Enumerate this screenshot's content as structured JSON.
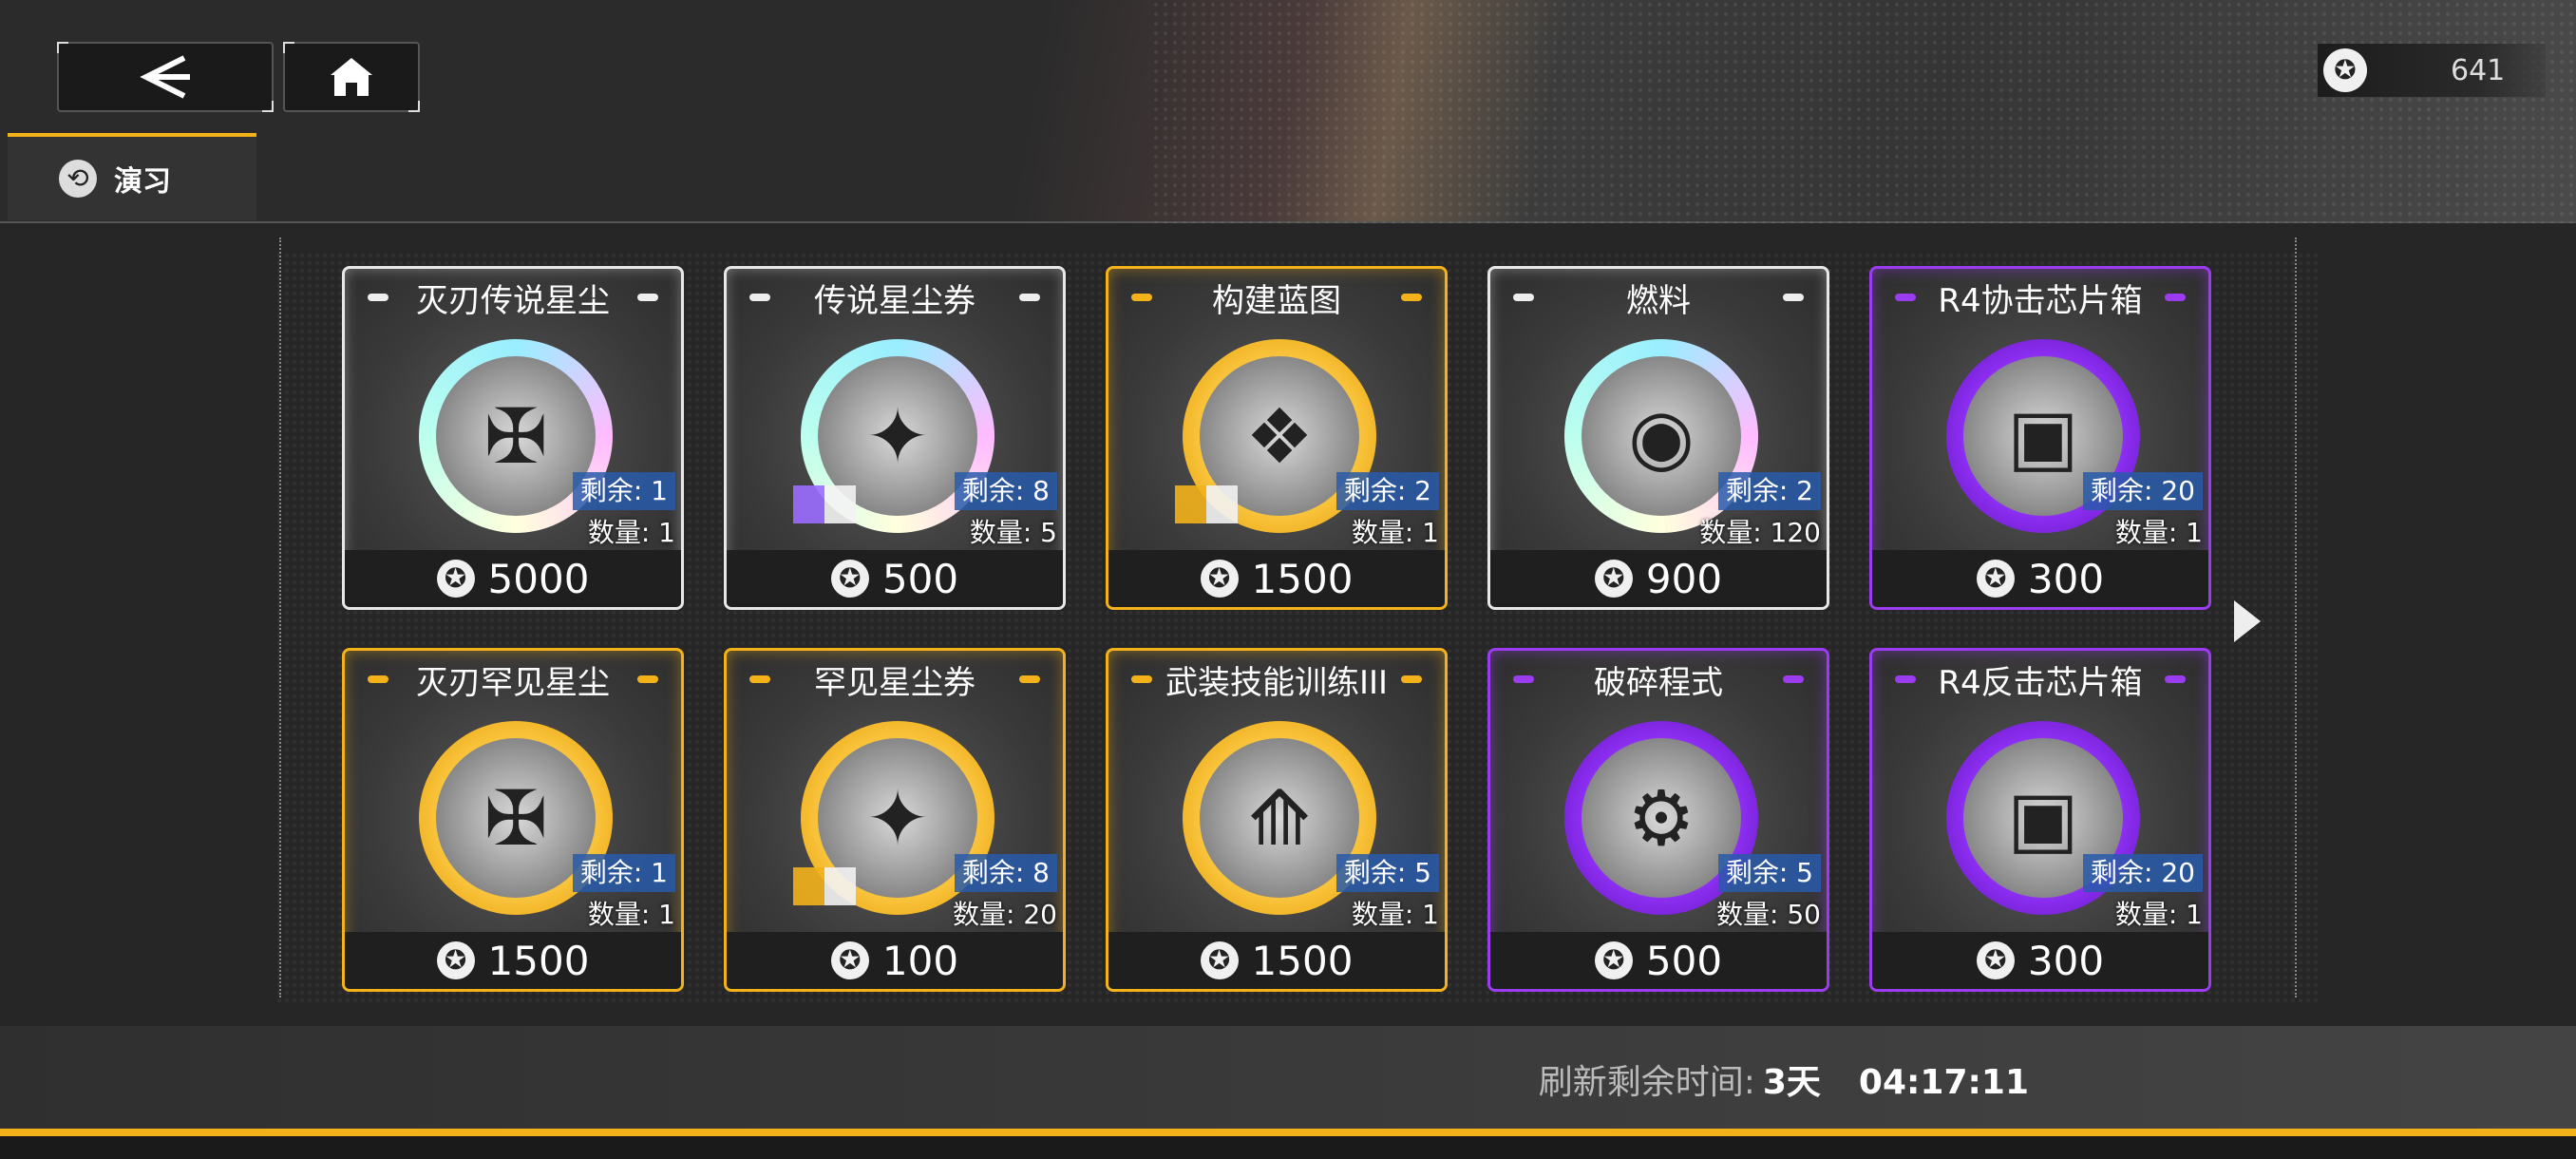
{
  "header": {
    "back_icon": "chevron-left-icon",
    "home_icon": "home-icon",
    "currency": {
      "icon": "star-coin-icon",
      "amount": "641"
    }
  },
  "tab": {
    "icon": "refresh-icon",
    "label": "演习"
  },
  "items": [
    {
      "name": "灭刃传说星尘",
      "rarity": "white",
      "icon": "legend-stardust-icon",
      "remain": "剩余: 1",
      "qty": "数量: 1",
      "price": "5000"
    },
    {
      "name": "传说星尘券",
      "rarity": "white",
      "icon": "legend-ticket-icon",
      "remain": "剩余: 8",
      "qty": "数量: 5",
      "price": "500"
    },
    {
      "name": "构建蓝图",
      "rarity": "gold",
      "icon": "blueprint-icon",
      "remain": "剩余: 2",
      "qty": "数量: 1",
      "price": "1500"
    },
    {
      "name": "燃料",
      "rarity": "white",
      "icon": "fuel-icon",
      "remain": "剩余: 2",
      "qty": "数量: 120",
      "price": "900"
    },
    {
      "name": "R4协击芯片箱",
      "rarity": "purple",
      "icon": "chip-box-icon",
      "remain": "剩余: 20",
      "qty": "数量: 1",
      "price": "300"
    },
    {
      "name": "灭刃罕见星尘",
      "rarity": "gold",
      "icon": "rare-stardust-icon",
      "remain": "剩余: 1",
      "qty": "数量: 1",
      "price": "1500"
    },
    {
      "name": "罕见星尘券",
      "rarity": "gold",
      "icon": "rare-ticket-icon",
      "remain": "剩余: 8",
      "qty": "数量: 20",
      "price": "100"
    },
    {
      "name": "武装技能训练III",
      "rarity": "gold",
      "icon": "skill-training-icon",
      "remain": "剩余: 5",
      "qty": "数量: 1",
      "price": "1500"
    },
    {
      "name": "破碎程式",
      "rarity": "purple",
      "icon": "broken-program-icon",
      "remain": "剩余: 5",
      "qty": "数量: 50",
      "price": "500"
    },
    {
      "name": "R4反击芯片箱",
      "rarity": "purple",
      "icon": "chip-box-icon",
      "remain": "剩余: 20",
      "qty": "数量: 1",
      "price": "300"
    }
  ],
  "footer": {
    "refresh_label": "刷新剩余时间:",
    "days": "3天",
    "time": "04:17:11"
  },
  "colors": {
    "accent": "#f3b21a",
    "white_rarity": "#e8e8e8",
    "gold_rarity": "#f3b21a",
    "purple_rarity": "#9b3cf0",
    "remain_badge": "#2c5aaa"
  }
}
